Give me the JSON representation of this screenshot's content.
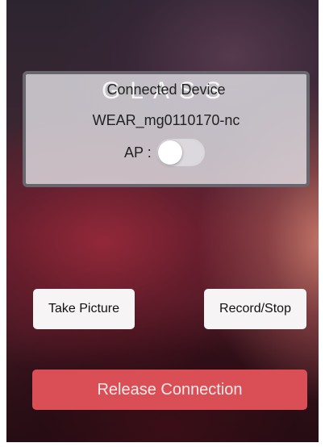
{
  "colors": {
    "accent_red": "#d94f55",
    "panel_bg": "#e1dfe4",
    "button_bg": "#f7f4f6"
  },
  "brand": {
    "logo_text": "GLASS"
  },
  "device_panel": {
    "title": "Connected Device",
    "device_name": "WEAR_mg0110170-nc",
    "ap_label": "AP :",
    "ap_enabled": false
  },
  "actions": {
    "take_picture_label": "Take Picture",
    "record_stop_label": "Record/Stop",
    "release_label": "Release Connection"
  }
}
